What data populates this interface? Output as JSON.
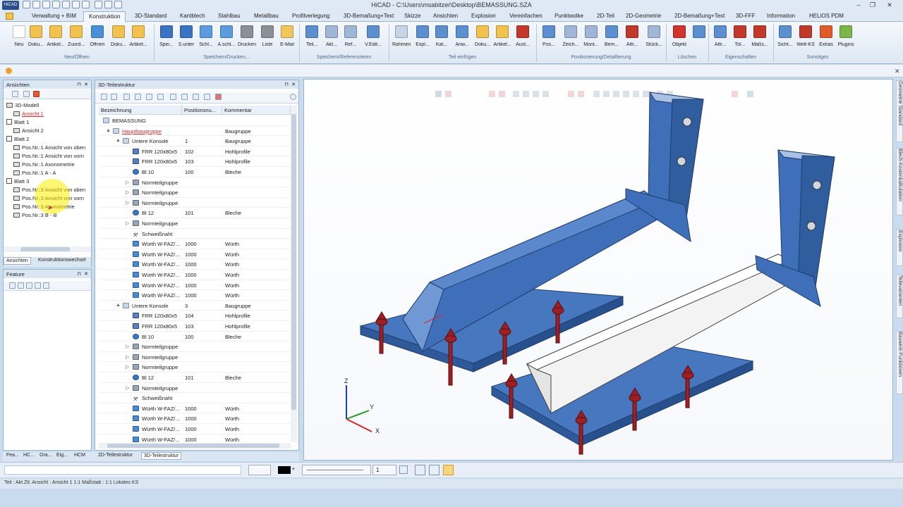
{
  "app": {
    "title": "HiCAD - C:\\Users\\msabitzer\\Desktop\\BEMASSUNG.SZA",
    "logo": "hicad-logo"
  },
  "window_controls": {
    "minimize": "–",
    "restore": "❐",
    "close": "✕"
  },
  "menu_tabs": [
    "Verwaltung + BIM",
    "Konstruktion",
    "3D-Standard",
    "Kantblech",
    "Stahlbau",
    "Metallbau",
    "Profilverlegung",
    "3D-Bemaßung+Text",
    "Skizze",
    "Ansichten",
    "Explosion",
    "Vereinfachen",
    "Punktwolke",
    "2D-Teil",
    "2D-Geometrie",
    "2D-Bemaßung+Text",
    "3D-FFF",
    "Information",
    "HELiOS PDM"
  ],
  "active_tab": "Konstruktion",
  "ribbon": {
    "buttons": [
      {
        "label": "Neu",
        "color": "#ffffff"
      },
      {
        "label": "Doku...",
        "color": "#f2c14e"
      },
      {
        "label": "Artikel...",
        "color": "#f2c14e"
      },
      {
        "label": "Zuord...",
        "color": "#f2c14e"
      },
      {
        "label": "Öffnen",
        "color": "#4a90d9"
      },
      {
        "label": "Doku...",
        "color": "#f2c14e"
      },
      {
        "label": "Artikel...",
        "color": "#f2c14e"
      },
      {
        "label": "Spei...",
        "color": "#3b73c4"
      },
      {
        "label": "S.unter",
        "color": "#3b73c4"
      },
      {
        "label": "Schl...",
        "color": "#5b9be0"
      },
      {
        "label": "A.schl...",
        "color": "#5b9be0"
      },
      {
        "label": "Drucken",
        "color": "#8a8f99"
      },
      {
        "label": "Liste",
        "color": "#8a8f99"
      },
      {
        "label": "E-Mail",
        "color": "#f0c75e"
      },
      {
        "label": "Teil...",
        "color": "#5b8fd0"
      },
      {
        "label": "Akt...",
        "color": "#9fb6d6"
      },
      {
        "label": "Ref...",
        "color": "#9fb6d6"
      },
      {
        "label": "V.Edit...",
        "color": "#5b8fd0"
      },
      {
        "label": "Rahmen",
        "color": "#c6d4e6"
      },
      {
        "label": "Expl...",
        "color": "#5b8fd0"
      },
      {
        "label": "Kat...",
        "color": "#5b8fd0"
      },
      {
        "label": "Anw...",
        "color": "#5b8fd0"
      },
      {
        "label": "Doku...",
        "color": "#f2c14e"
      },
      {
        "label": "Artikel...",
        "color": "#f2c14e"
      },
      {
        "label": "Aust...",
        "color": "#c0392b"
      },
      {
        "label": "Pos...",
        "color": "#5b8fd0"
      },
      {
        "label": "Zeich...",
        "color": "#9fb6d6"
      },
      {
        "label": "Mont...",
        "color": "#9fb6d6"
      },
      {
        "label": "Bem...",
        "color": "#5b8fd0"
      },
      {
        "label": "Attr...",
        "color": "#c0392b"
      },
      {
        "label": "Stück...",
        "color": "#9fb6d6"
      },
      {
        "label": "Objekt",
        "color": "#d0342c"
      },
      {
        "label": "",
        "color": "#5b8fd0"
      },
      {
        "label": "Attr...",
        "color": "#5b8fd0"
      },
      {
        "label": "Tol...",
        "color": "#c0392b"
      },
      {
        "label": "Maßs...",
        "color": "#c0392b"
      },
      {
        "label": "Sicht...",
        "color": "#5b8fd0"
      },
      {
        "label": "Welt-KS",
        "color": "#c0392b"
      },
      {
        "label": "Extras",
        "color": "#e05a2b"
      },
      {
        "label": "Plugins",
        "color": "#7ab648"
      }
    ],
    "groups": [
      "Neu/Öffnen",
      "Speichern/Drucken...",
      "Speichern/Referenzieren",
      "Teil einfügen",
      "Positionierung/Detaillierung",
      "Löschen",
      "Eigenschaften",
      "Sonstiges"
    ]
  },
  "ansichten": {
    "title": "Ansichten",
    "items": [
      {
        "label": "3D-Modell",
        "indent": 0,
        "kind": "cube"
      },
      {
        "label": "Ansicht 1",
        "indent": 1,
        "kind": "view",
        "active": true
      },
      {
        "label": "Blatt 1",
        "indent": 0,
        "kind": "sheet"
      },
      {
        "label": "Ansicht 2",
        "indent": 1,
        "kind": "view"
      },
      {
        "label": "Blatt 2",
        "indent": 0,
        "kind": "sheet"
      },
      {
        "label": "Pos.Nr.:1 Ansicht von oben",
        "indent": 1,
        "kind": "view"
      },
      {
        "label": "Pos.Nr.:1 Ansicht von vorn",
        "indent": 1,
        "kind": "view"
      },
      {
        "label": "Pos.Nr.:1 Axonometrie",
        "indent": 1,
        "kind": "view"
      },
      {
        "label": "Pos.Nr.:1 A - A",
        "indent": 1,
        "kind": "view"
      },
      {
        "label": "Blatt 3",
        "indent": 0,
        "kind": "sheet"
      },
      {
        "label": "Pos.Nr.:3 Ansicht von oben",
        "indent": 1,
        "kind": "view"
      },
      {
        "label": "Pos.Nr.:3 Ansicht von vorn",
        "indent": 1,
        "kind": "view"
      },
      {
        "label": "Pos.Nr.:3 Axonometrie",
        "indent": 1,
        "kind": "view"
      },
      {
        "label": "Pos.Nr.:3 B - B",
        "indent": 1,
        "kind": "view"
      }
    ],
    "tabs": [
      "Ansichten",
      "Konstruktionswechsel"
    ]
  },
  "feature": {
    "title": "Feature"
  },
  "teilestruktur": {
    "title": "3D-Teilestruktur",
    "columns": [
      "Bezeichnung",
      "Positionsnu...",
      "Kommentar"
    ],
    "rows": [
      {
        "name": "BEMASSUNG",
        "pos": "",
        "comment": "",
        "indent": 0,
        "icon": "sheet",
        "arrow": ""
      },
      {
        "name": "Hauptbaugruppe",
        "pos": "",
        "comment": "Baugruppe",
        "indent": 1,
        "icon": "grp",
        "arrow": "▲",
        "main": true
      },
      {
        "name": "Untere Konsole",
        "pos": "1",
        "comment": "Baugruppe",
        "indent": 2,
        "icon": "grp",
        "arrow": "▲"
      },
      {
        "name": "FRR 120x80x5",
        "pos": "102",
        "comment": "Hohlprofile",
        "indent": 3,
        "icon": "prof",
        "arrow": ""
      },
      {
        "name": "FRR 120x80x5",
        "pos": "103",
        "comment": "Hohlprofile",
        "indent": 3,
        "icon": "prof",
        "arrow": ""
      },
      {
        "name": "Bl 10",
        "pos": "100",
        "comment": "Bleche",
        "indent": 3,
        "icon": "plate",
        "arrow": ""
      },
      {
        "name": "Normteilgruppe",
        "pos": "",
        "comment": "",
        "indent": 3,
        "icon": "norm",
        "arrow": "▷"
      },
      {
        "name": "Normteilgruppe",
        "pos": "",
        "comment": "",
        "indent": 3,
        "icon": "norm",
        "arrow": "▷"
      },
      {
        "name": "Normteilgruppe",
        "pos": "",
        "comment": "",
        "indent": 3,
        "icon": "norm",
        "arrow": "▷"
      },
      {
        "name": "Bl 12",
        "pos": "101",
        "comment": "Bleche",
        "indent": 3,
        "icon": "plate",
        "arrow": ""
      },
      {
        "name": "Normteilgruppe",
        "pos": "",
        "comment": "",
        "indent": 3,
        "icon": "norm",
        "arrow": "▷"
      },
      {
        "name": "Schweißnaht",
        "pos": "",
        "comment": "",
        "indent": 3,
        "icon": "weld",
        "arrow": ""
      },
      {
        "name": "Würth W-FAZ/...",
        "pos": "1000",
        "comment": "Würth",
        "indent": 3,
        "icon": "bolt",
        "arrow": ""
      },
      {
        "name": "Würth W-FAZ/...",
        "pos": "1000",
        "comment": "Würth",
        "indent": 3,
        "icon": "bolt",
        "arrow": ""
      },
      {
        "name": "Würth W-FAZ/...",
        "pos": "1000",
        "comment": "Würth",
        "indent": 3,
        "icon": "bolt",
        "arrow": ""
      },
      {
        "name": "Würth W-FAZ/...",
        "pos": "1000",
        "comment": "Würth",
        "indent": 3,
        "icon": "bolt",
        "arrow": ""
      },
      {
        "name": "Würth W-FAZ/...",
        "pos": "1000",
        "comment": "Würth",
        "indent": 3,
        "icon": "bolt",
        "arrow": ""
      },
      {
        "name": "Würth W-FAZ/...",
        "pos": "1000",
        "comment": "Würth",
        "indent": 3,
        "icon": "bolt",
        "arrow": ""
      },
      {
        "name": "Untere Konsole",
        "pos": "3",
        "comment": "Baugruppe",
        "indent": 2,
        "icon": "grp",
        "arrow": "▲"
      },
      {
        "name": "FRR 120x80x5",
        "pos": "104",
        "comment": "Hohlprofile",
        "indent": 3,
        "icon": "prof",
        "arrow": ""
      },
      {
        "name": "FRR 120x80x5",
        "pos": "103",
        "comment": "Hohlprofile",
        "indent": 3,
        "icon": "prof",
        "arrow": ""
      },
      {
        "name": "Bl 10",
        "pos": "100",
        "comment": "Bleche",
        "indent": 3,
        "icon": "plate",
        "arrow": ""
      },
      {
        "name": "Normteilgruppe",
        "pos": "",
        "comment": "",
        "indent": 3,
        "icon": "norm",
        "arrow": "▷"
      },
      {
        "name": "Normteilgruppe",
        "pos": "",
        "comment": "",
        "indent": 3,
        "icon": "norm",
        "arrow": "▷"
      },
      {
        "name": "Normteilgruppe",
        "pos": "",
        "comment": "",
        "indent": 3,
        "icon": "norm",
        "arrow": "▷"
      },
      {
        "name": "Bl 12",
        "pos": "101",
        "comment": "Bleche",
        "indent": 3,
        "icon": "plate",
        "arrow": ""
      },
      {
        "name": "Normteilgruppe",
        "pos": "",
        "comment": "",
        "indent": 3,
        "icon": "norm",
        "arrow": "▷"
      },
      {
        "name": "Schweißnaht",
        "pos": "",
        "comment": "",
        "indent": 3,
        "icon": "weld",
        "arrow": ""
      },
      {
        "name": "Würth W-FAZ/...",
        "pos": "1000",
        "comment": "Würth",
        "indent": 3,
        "icon": "bolt",
        "arrow": ""
      },
      {
        "name": "Würth W-FAZ/...",
        "pos": "1000",
        "comment": "Würth",
        "indent": 3,
        "icon": "bolt",
        "arrow": ""
      },
      {
        "name": "Würth W-FAZ/...",
        "pos": "1000",
        "comment": "Würth",
        "indent": 3,
        "icon": "bolt",
        "arrow": ""
      },
      {
        "name": "Würth W-FAZ/...",
        "pos": "1000",
        "comment": "Würth",
        "indent": 3,
        "icon": "bolt",
        "arrow": ""
      }
    ]
  },
  "bottom_tabs": [
    "Fea...",
    "HC...",
    "Gra...",
    "Eig...",
    "HCM",
    "2D-Teilestruktur",
    "3D-Teilestruktur"
  ],
  "active_bottom_tab": "3D-Teilestruktur",
  "side_tabs": [
    "Geometrie Standard",
    "Blech-Kostenkalkulation",
    "Explosion",
    "Teilevarianten",
    "Bauwerk-Funktionen"
  ],
  "linewidth_value": "1",
  "axes": {
    "x": "X",
    "y": "Y",
    "z": "Z"
  },
  "status": {
    "text": "Teil : Akt.Ztl.   Ansicht : Ansicht 1 1:1   Maßstab : 1:1   Lokales KS"
  },
  "colors": {
    "steel_blue": "#3e6fb8",
    "bolt_red": "#9c1f24",
    "white_profile": "#f2f2f2",
    "accent": "#d7282f"
  }
}
